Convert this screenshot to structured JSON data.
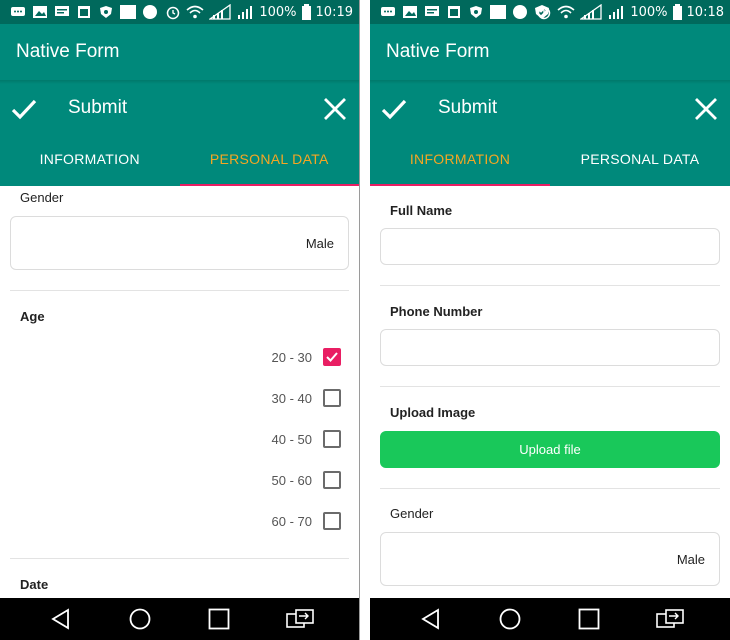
{
  "left_screen": {
    "status": {
      "battery": "100%",
      "time": "10:19"
    },
    "app_title": "Native Form",
    "action": {
      "submit": "Submit"
    },
    "tabs": [
      {
        "label": "INFORMATION",
        "active": false
      },
      {
        "label": "PERSONAL DATA",
        "active": true
      }
    ],
    "form": {
      "gender_label": "Gender",
      "gender_value": "Male",
      "age_label": "Age",
      "age_options": [
        {
          "label": "20 - 30",
          "checked": true
        },
        {
          "label": "30 - 40",
          "checked": false
        },
        {
          "label": "40 - 50",
          "checked": false
        },
        {
          "label": "50 - 60",
          "checked": false
        },
        {
          "label": "60 - 70",
          "checked": false
        }
      ],
      "date_label": "Date"
    }
  },
  "right_screen": {
    "status": {
      "battery": "100%",
      "time": "10:18"
    },
    "app_title": "Native Form",
    "action": {
      "submit": "Submit"
    },
    "tabs": [
      {
        "label": "INFORMATION",
        "active": true
      },
      {
        "label": "PERSONAL DATA",
        "active": false
      }
    ],
    "form": {
      "full_name_label": "Full Name",
      "full_name_value": "",
      "phone_label": "Phone Number",
      "phone_value": "",
      "upload_label": "Upload Image",
      "upload_button": "Upload file",
      "gender_label": "Gender",
      "gender_value": "Male"
    }
  },
  "colors": {
    "status_bar": "#00695c",
    "app_bar": "#00897b",
    "active_tab_text": "#f5a623",
    "tab_indicator": "#e91e63",
    "checkbox_checked": "#e91e63",
    "upload_button": "#19c85a"
  },
  "icons": [
    "check-icon",
    "close-icon",
    "nav-back-icon",
    "nav-home-icon",
    "nav-recents-icon",
    "nav-switch-icon",
    "wifi-icon",
    "signal-icon",
    "alarm-icon",
    "battery-icon"
  ]
}
